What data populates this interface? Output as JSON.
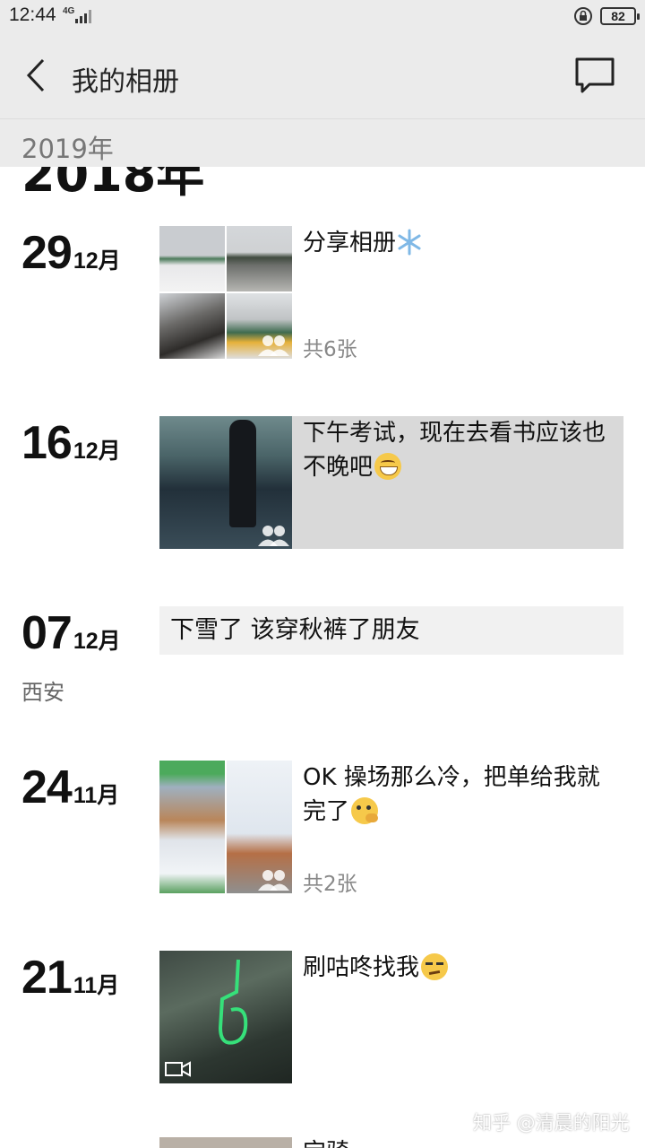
{
  "status_bar": {
    "time": "12:44",
    "network": "4G",
    "battery": "82"
  },
  "header": {
    "title": "我的相册"
  },
  "years": {
    "sticky": "2019年",
    "current": "2018年"
  },
  "entries": [
    {
      "day": "29",
      "month": "12月",
      "text": "分享相册",
      "count": "共6张"
    },
    {
      "day": "16",
      "month": "12月",
      "text": "下午考试，现在去看书应该也不晚吧"
    },
    {
      "day": "07",
      "month": "12月",
      "text": "下雪了 该穿秋裤了朋友",
      "location": "西安"
    },
    {
      "day": "24",
      "month": "11月",
      "text": "OK 操场那么冷，把单给我就完了",
      "count": "共2张"
    },
    {
      "day": "21",
      "month": "11月",
      "text": "刷咕咚找我"
    }
  ],
  "partial_entry_text": "宝骑",
  "watermark": "知乎 @清晨的阳光",
  "colors": {
    "bar_bg": "#ebebeb",
    "highlight_bg": "#d9d9d9",
    "text_card_bg": "#f1f1f1"
  }
}
